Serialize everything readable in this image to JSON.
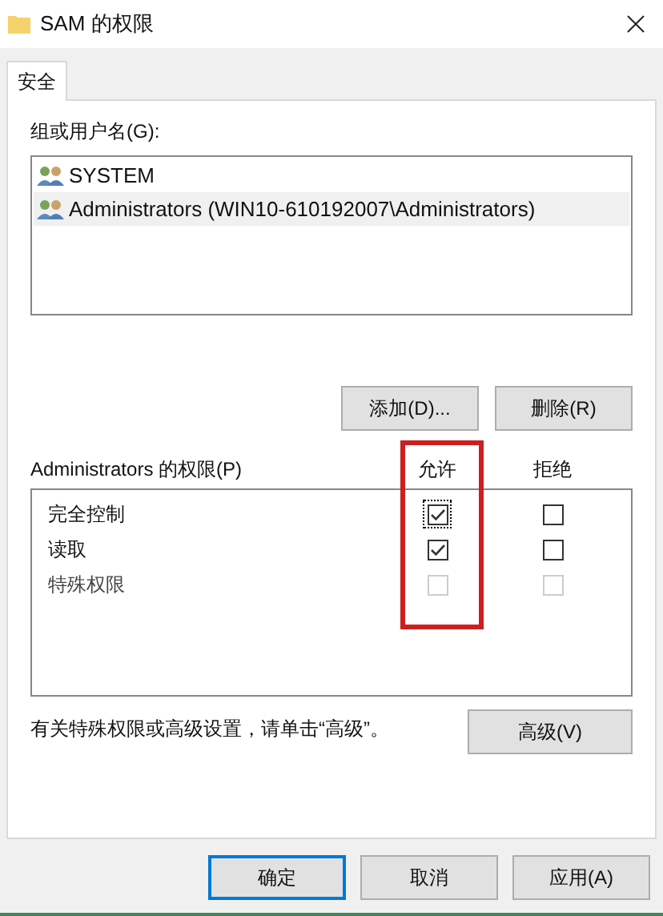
{
  "window": {
    "title": "SAM 的权限"
  },
  "tabs": [
    {
      "label": "安全",
      "selected": true
    }
  ],
  "users": {
    "label": "组或用户名(G):",
    "items": [
      {
        "name": "SYSTEM",
        "selected": false
      },
      {
        "name": "Administrators (WIN10-610192007\\Administrators)",
        "selected": true
      }
    ]
  },
  "user_buttons": [
    "添加(D)...",
    "删除(R)"
  ],
  "permissions": {
    "label": "Administrators 的权限(P)",
    "allow_header": "允许",
    "deny_header": "拒绝",
    "allow_column_highlighted": true,
    "items": [
      {
        "name": "完全控制",
        "allow": {
          "checked": true,
          "disabled": false,
          "focused": true
        },
        "deny": {
          "checked": false,
          "disabled": false,
          "focused": false
        }
      },
      {
        "name": "读取",
        "allow": {
          "checked": true,
          "disabled": false,
          "focused": false
        },
        "deny": {
          "checked": false,
          "disabled": false,
          "focused": false
        }
      },
      {
        "name": "特殊权限",
        "allow": {
          "checked": false,
          "disabled": true,
          "focused": false
        },
        "deny": {
          "checked": false,
          "disabled": true,
          "focused": false
        }
      }
    ]
  },
  "advanced": {
    "hint": "有关特殊权限或高级设置，请单击“高级”。",
    "button": "高级(V)"
  },
  "buttons": [
    {
      "label": "确定",
      "default": true
    },
    {
      "label": "取消",
      "default": false
    },
    {
      "label": "应用(A)",
      "default": false
    }
  ]
}
